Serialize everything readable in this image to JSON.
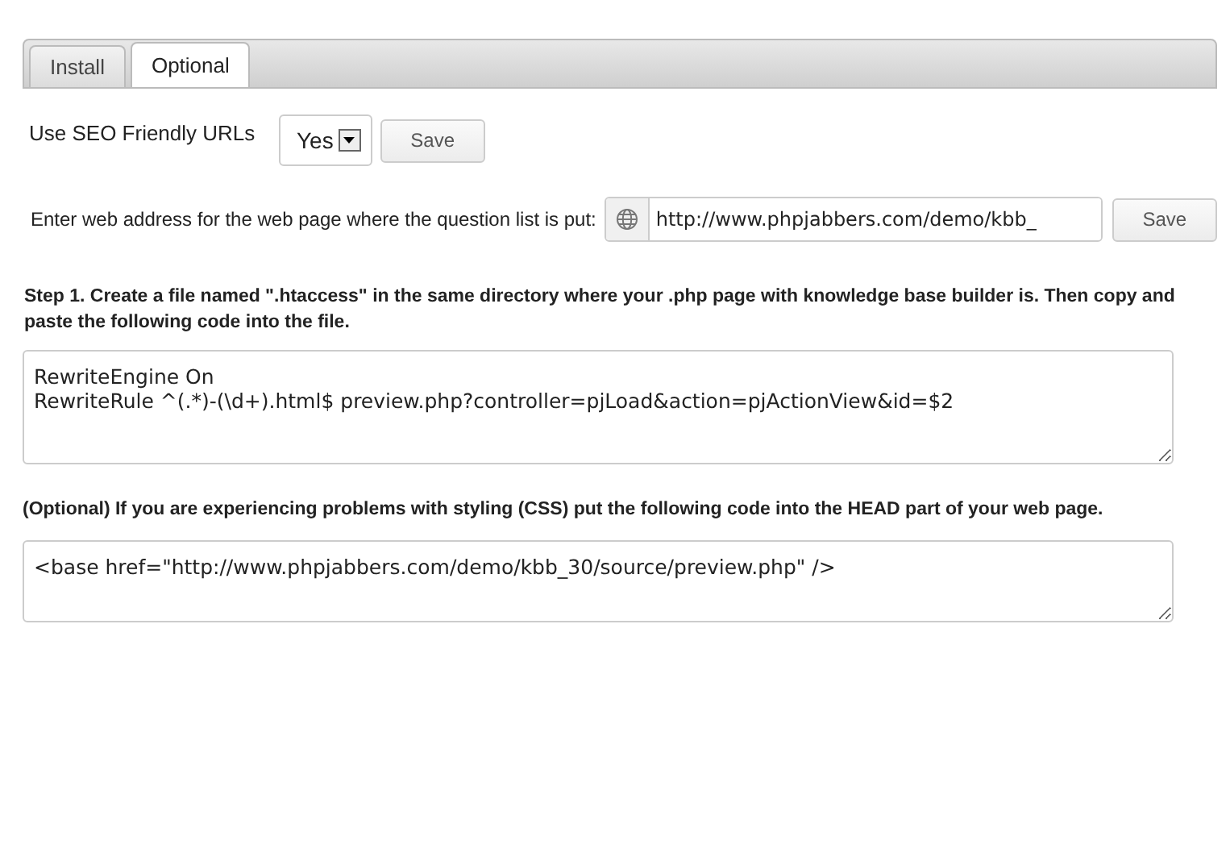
{
  "tabs": [
    {
      "label": "Install",
      "selected": false
    },
    {
      "label": "Optional",
      "selected": true
    }
  ],
  "seo": {
    "label": "Use SEO Friendly URLs",
    "value": "Yes",
    "button": "Save"
  },
  "web_address": {
    "label": "Enter web address for the web page where the question list is put:",
    "value": "http://www.phpjabbers.com/demo/kbb_",
    "button": "Save"
  },
  "step1": {
    "text": "Step 1. Create a file named \".htaccess\" in the same directory where your .php page with knowledge base builder is. Then copy and paste the following code into the file.",
    "code": "RewriteEngine On\nRewriteRule ^(.*)-(\\d+).html$ preview.php?controller=pjLoad&action=pjActionView&id=$2"
  },
  "optional": {
    "text": "(Optional) If you are experiencing problems with styling (CSS) put the following code into the HEAD part of your web page.",
    "code": "<base href=\"http://www.phpjabbers.com/demo/kbb_30/source/preview.php\" />"
  }
}
